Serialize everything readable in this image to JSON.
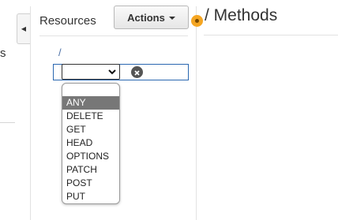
{
  "left_nav": {
    "partial_label": "s"
  },
  "resources": {
    "title": "Resources",
    "actions_label": "Actions",
    "root_path": "/"
  },
  "method_selector": {
    "selected": "ANY",
    "options": [
      "ANY",
      "DELETE",
      "GET",
      "HEAD",
      "OPTIONS",
      "PATCH",
      "POST",
      "PUT"
    ]
  },
  "methods_panel": {
    "title": "/ Methods"
  },
  "colors": {
    "accent_border": "#2a67b0",
    "handle": "#f5a623",
    "selected_option_bg": "#777777"
  },
  "icons": {
    "collapse": "chevron-left-icon",
    "actions": "caret-down-icon",
    "select": "chevron-down-icon",
    "cancel": "close-circle-icon",
    "handle": "resize-handle-icon"
  }
}
